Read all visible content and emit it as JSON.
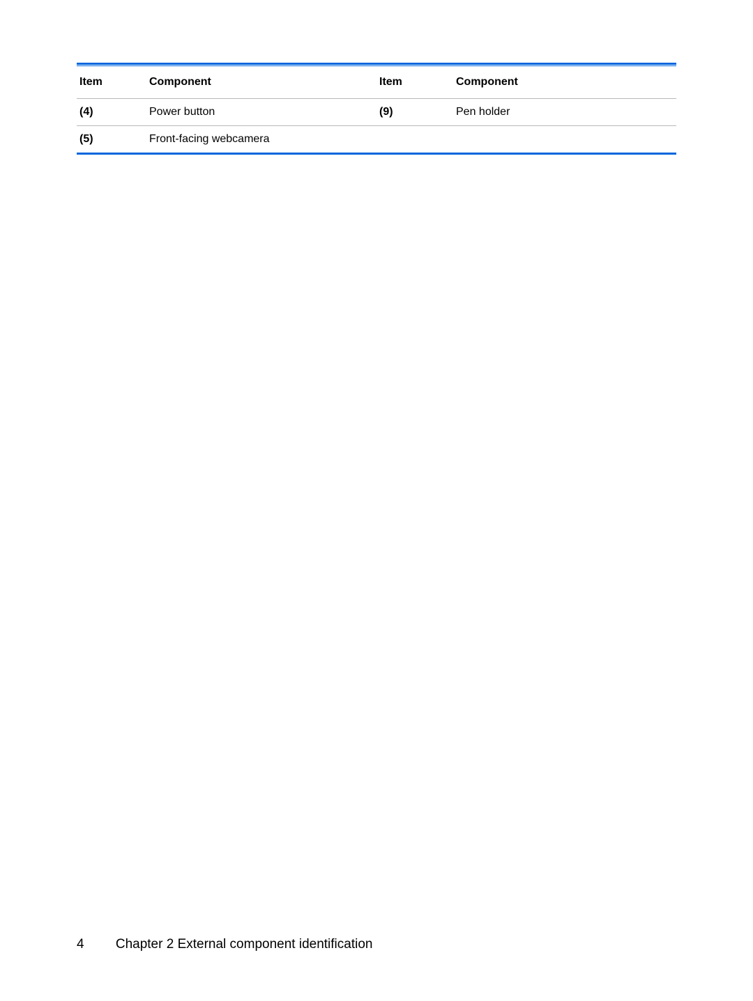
{
  "table": {
    "headers": {
      "item1": "Item",
      "component1": "Component",
      "item2": "Item",
      "component2": "Component"
    },
    "rows": [
      {
        "item1": "(4)",
        "component1": "Power button",
        "item2": "(9)",
        "component2": "Pen holder"
      },
      {
        "item1": "(5)",
        "component1": "Front-facing webcamera",
        "item2": "",
        "component2": ""
      }
    ]
  },
  "footer": {
    "pageNumber": "4",
    "chapterText": "Chapter 2   External component identification"
  }
}
